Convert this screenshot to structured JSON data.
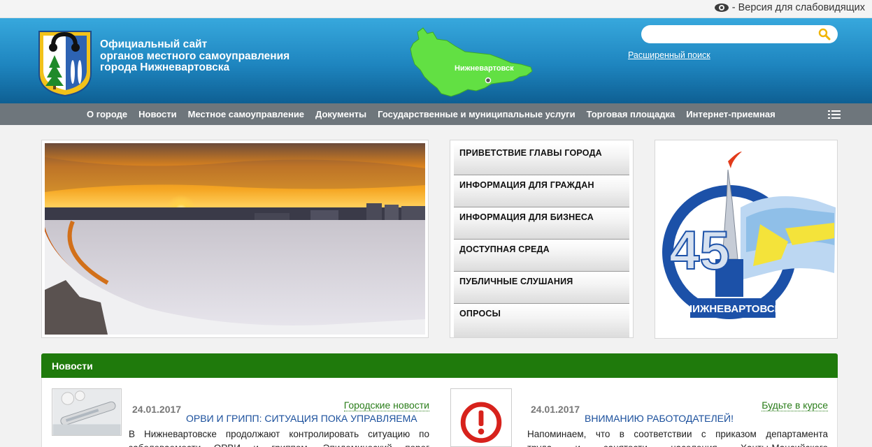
{
  "topbar": {
    "accessibility_label": "- Версия для слабовидящих"
  },
  "header": {
    "title_lines": [
      "Официальный сайт",
      "органов местного самоуправления",
      "города Нижневартовска"
    ],
    "map_label": "Нижневартовск",
    "search": {
      "placeholder": "",
      "value": ""
    },
    "advanced_search": "Расширенный поиск"
  },
  "nav": {
    "items": [
      "О городе",
      "Новости",
      "Местное самоуправление",
      "Документы",
      "Государственные и муниципальные услуги",
      "Торговая площадка",
      "Интернет-приемная"
    ]
  },
  "quick_links": [
    "ПРИВЕТСТВИЕ ГЛАВЫ ГОРОДА",
    "ИНФОРМАЦИЯ ДЛЯ ГРАЖДАН",
    "ИНФОРМАЦИЯ ДЛЯ БИЗНЕСА",
    "ДОСТУПНАЯ СРЕДА",
    "ПУБЛИЧНЫЕ СЛУШАНИЯ",
    "ОПРОСЫ"
  ],
  "anniversary": {
    "number": "45",
    "city": "НИЖНЕВАРТОВСК"
  },
  "news": {
    "section_title": "Новости",
    "items": [
      {
        "date": "24.01.2017",
        "category": "Городские новости",
        "headline": "ОРВИ И ГРИПП: СИТУАЦИЯ ПОКА УПРАВЛЯЕМА",
        "text_lines": [
          "В Нижневартовске продолжают контролировать ситуацию по",
          "заболеваемости ОРВИ и гриппом. Эпидемический порог"
        ]
      },
      {
        "date": "24.01.2017",
        "category": "Будьте в курсе",
        "headline": "ВНИМАНИЮ РАБОТОДАТЕЛЕЙ!",
        "text_lines": [
          "Напоминаем, что в соответствии с приказом департамента",
          "труда и занятости населения Ханты-Мансийского"
        ]
      }
    ]
  },
  "colors": {
    "header_blue": "#1e85bf",
    "nav_gray": "#6e767c",
    "news_green": "#1f7a0c",
    "map_green": "#62e043",
    "link_blue": "#1a4f9c"
  }
}
